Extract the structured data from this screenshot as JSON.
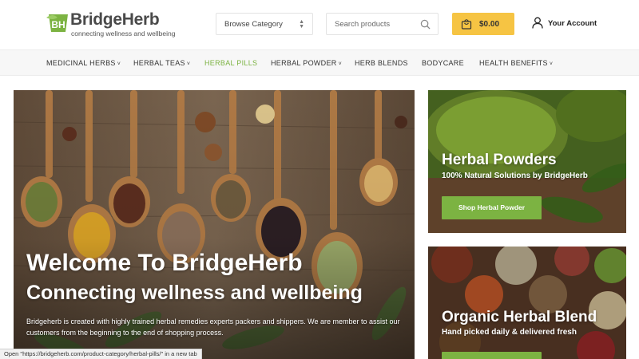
{
  "header": {
    "logo_badge": "BH",
    "logo_name": "BridgeHerb",
    "logo_tagline": "connecting wellness and wellbeing",
    "browse_label": "Browse Category",
    "search_placeholder": "Search products",
    "cart_amount": "$0.00",
    "account_label": "Your Account"
  },
  "nav": {
    "items": [
      {
        "label": "MEDICINAL HERBS",
        "has_dropdown": true
      },
      {
        "label": "HERBAL TEAS",
        "has_dropdown": true
      },
      {
        "label": "HERBAL PILLS",
        "has_dropdown": false,
        "active": true
      },
      {
        "label": "HERBAL POWDER",
        "has_dropdown": true
      },
      {
        "label": "HERB BLENDS",
        "has_dropdown": false
      },
      {
        "label": "BODYCARE",
        "has_dropdown": false
      },
      {
        "label": "HEALTH BENEFITS",
        "has_dropdown": true
      }
    ]
  },
  "hero": {
    "title": "Welcome To BridgeHerb",
    "subtitle": "Connecting wellness and wellbeing",
    "description": "Bridgeherb is created with highly trained herbal remedies experts packers and shippers. We are member to assist our customers from the beginning to the end of shopping process."
  },
  "promos": [
    {
      "title": "Herbal Powders",
      "subtitle": "100% Natural Solutions by BridgeHerb",
      "button": "Shop Herbal Powder"
    },
    {
      "title": "Organic Herbal Blend",
      "subtitle": "Hand picked daily & delivered fresh",
      "button": ""
    }
  ],
  "status_bar": "Open \"https://bridgeherb.com/product-category/herbal-pills/\" in a new tab",
  "colors": {
    "accent_green": "#7cb342",
    "cart_yellow": "#f6c443",
    "nav_bg": "#f7f7f7"
  }
}
